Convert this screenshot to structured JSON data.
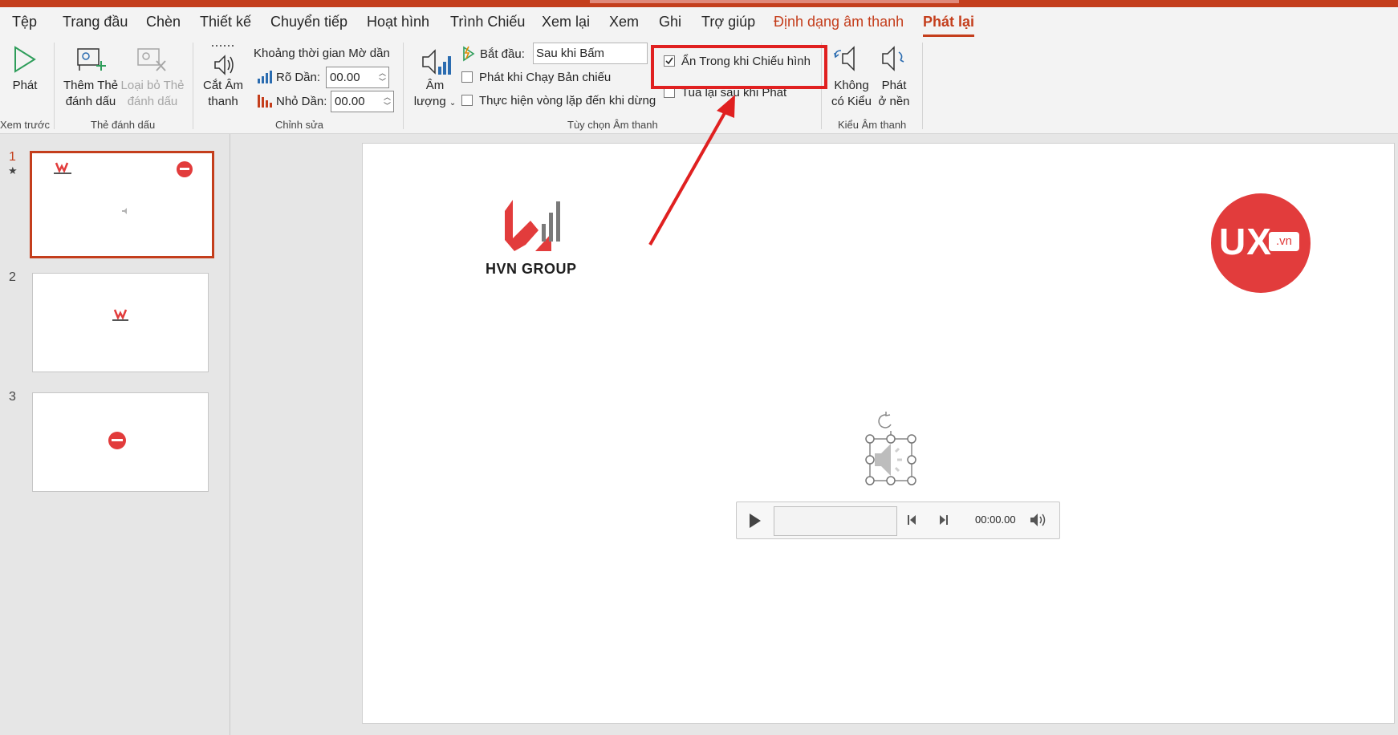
{
  "tabs": [
    {
      "label": "Tệp"
    },
    {
      "label": "Trang đầu"
    },
    {
      "label": "Chèn"
    },
    {
      "label": "Thiết kế"
    },
    {
      "label": "Chuyển tiếp"
    },
    {
      "label": "Hoạt hình"
    },
    {
      "label": "Trình Chiếu"
    },
    {
      "label": "Xem lại"
    },
    {
      "label": "Xem"
    },
    {
      "label": "Ghi"
    },
    {
      "label": "Trợ giúp"
    },
    {
      "label": "Định dạng âm thanh"
    },
    {
      "label": "Phát lại"
    }
  ],
  "ribbon": {
    "preview": {
      "play_label": "Phát",
      "group_label": "Xem trước"
    },
    "bookmarks": {
      "add_label_1": "Thêm Thẻ",
      "add_label_2": "đánh dấu",
      "remove_label_1": "Loại bỏ Thẻ",
      "remove_label_2": "đánh dấu",
      "group_label": "Thẻ đánh dấu"
    },
    "editing": {
      "trim_label_1": "Cắt Âm",
      "trim_label_2": "thanh",
      "fade_title": "Khoảng thời gian Mờ dần",
      "fade_in_label": "Rõ Dần:",
      "fade_in_value": "00.00",
      "fade_out_label": "Nhỏ Dần:",
      "fade_out_value": "00.00",
      "group_label": "Chỉnh sửa"
    },
    "audio_options": {
      "volume_label_1": "Âm",
      "volume_label_2": "lượng",
      "start_label": "Bắt đầu:",
      "start_value": "Sau khi Bấm",
      "play_across_slides": "Phát khi Chạy Bản chiếu",
      "loop_until_stopped": "Thực hiện vòng lặp đến khi dừng",
      "hide_during_show": "Ẩn Trong khi Chiếu hình",
      "rewind_after_playing": "Tua lại sau khi Phát",
      "play_across_slides_checked": false,
      "loop_until_stopped_checked": false,
      "hide_during_show_checked": true,
      "rewind_after_playing_checked": false,
      "group_label": "Tùy chọn Âm thanh"
    },
    "audio_styles": {
      "no_style_label_1": "Không",
      "no_style_label_2": "có Kiểu",
      "background_label_1": "Phát",
      "background_label_2": "ở nền",
      "group_label": "Kiểu Âm thanh"
    }
  },
  "slides": [
    {
      "number": "1",
      "active": true
    },
    {
      "number": "2",
      "active": false
    },
    {
      "number": "3",
      "active": false
    }
  ],
  "canvas": {
    "hvn_logo_text": "HVN GROUP",
    "ux_logo_text": "UX",
    "ux_logo_suffix": ".vn"
  },
  "player": {
    "time": "00:00.00"
  },
  "colors": {
    "accent": "#c43e1c",
    "highlight_box": "#e02020",
    "ux_red": "#e23c3c"
  }
}
